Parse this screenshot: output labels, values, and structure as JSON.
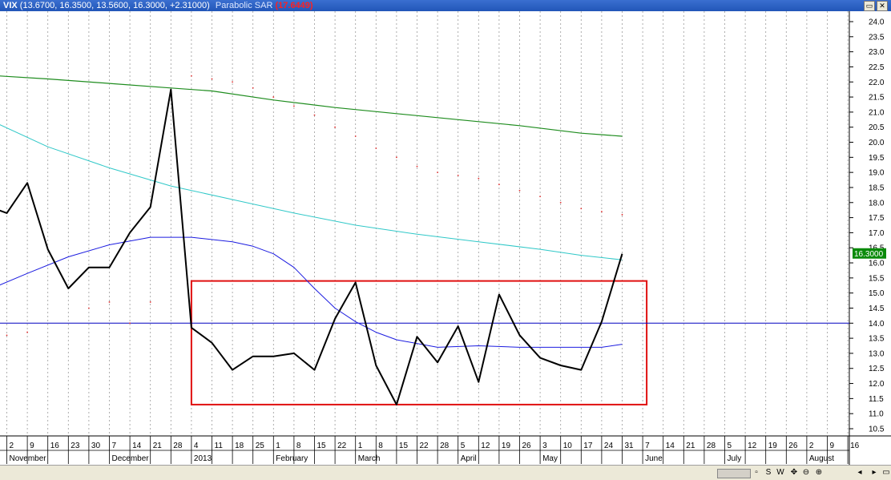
{
  "header": {
    "symbol": "VIX",
    "ohlc": "(13.6700, 16.3500, 13.5600, 16.3000, +2.31000)",
    "indicator_name": "Parabolic SAR",
    "indicator_value": "(17.6449)"
  },
  "window_buttons": {
    "restore": "▭",
    "close": "✕"
  },
  "last_price_tag": "16.3000",
  "colors": {
    "price": "#000000",
    "sma_slow": "#1e8c1e",
    "sma_mid": "#30c8c8",
    "sma_fast": "#1c1ce0",
    "hline": "#0000c0",
    "box": "#e01010",
    "sar": "#e03030"
  },
  "chart_data": {
    "type": "line",
    "title": "",
    "ylim": [
      10.2,
      24.3
    ],
    "y_ticks": [
      "24.0",
      "23.5",
      "23.0",
      "22.5",
      "22.0",
      "21.5",
      "21.0",
      "20.5",
      "20.0",
      "19.5",
      "19.0",
      "18.5",
      "18.0",
      "17.5",
      "17.0",
      "16.5",
      "16.0",
      "15.5",
      "15.0",
      "14.5",
      "14.0",
      "13.5",
      "13.0",
      "12.5",
      "12.0",
      "11.5",
      "11.0",
      "10.5"
    ],
    "x_week_labels": [
      "2",
      "9",
      "16",
      "23",
      "30",
      "7",
      "14",
      "21",
      "28",
      "4",
      "11",
      "18",
      "25",
      "1",
      "8",
      "15",
      "22",
      "1",
      "8",
      "15",
      "22",
      "28",
      "5",
      "12",
      "19",
      "26",
      "3",
      "10",
      "17",
      "24",
      "31",
      "7",
      "14",
      "21",
      "28",
      "5",
      "12",
      "19",
      "26",
      "2",
      "9",
      "16"
    ],
    "x_month_labels": [
      {
        "label": "November",
        "week": 0
      },
      {
        "label": "December",
        "week": 5
      },
      {
        "label": "2013",
        "week": 9
      },
      {
        "label": "February",
        "week": 13
      },
      {
        "label": "March",
        "week": 17
      },
      {
        "label": "April",
        "week": 22
      },
      {
        "label": "May",
        "week": 26
      },
      {
        "label": "June",
        "week": 31
      },
      {
        "label": "July",
        "week": 35
      },
      {
        "label": "August",
        "week": 39
      }
    ],
    "series": [
      {
        "values": [
          {
            "w": -0.4,
            "v": 17.75
          },
          {
            "w": 0,
            "v": 17.65
          },
          {
            "w": 1,
            "v": 18.65
          },
          {
            "w": 2,
            "v": 16.45
          },
          {
            "w": 3,
            "v": 15.15
          },
          {
            "w": 4,
            "v": 15.85
          },
          {
            "w": 5,
            "v": 15.85
          },
          {
            "w": 6,
            "v": 17.0
          },
          {
            "w": 7,
            "v": 17.85
          },
          {
            "w": 8,
            "v": 21.75
          },
          {
            "w": 9,
            "v": 13.85
          },
          {
            "w": 10,
            "v": 13.35
          },
          {
            "w": 11,
            "v": 12.45
          },
          {
            "w": 12,
            "v": 12.9
          },
          {
            "w": 13,
            "v": 12.9
          },
          {
            "w": 14,
            "v": 13.0
          },
          {
            "w": 15,
            "v": 12.45
          },
          {
            "w": 16,
            "v": 14.15
          },
          {
            "w": 17,
            "v": 15.35
          },
          {
            "w": 18,
            "v": 12.6
          },
          {
            "w": 19,
            "v": 11.3
          },
          {
            "w": 20,
            "v": 13.55
          },
          {
            "w": 21,
            "v": 12.7
          },
          {
            "w": 22,
            "v": 13.9
          },
          {
            "w": 23,
            "v": 12.05
          },
          {
            "w": 24,
            "v": 14.95
          },
          {
            "w": 25,
            "v": 13.6
          },
          {
            "w": 26,
            "v": 12.85
          },
          {
            "w": 27,
            "v": 12.6
          },
          {
            "w": 28,
            "v": 12.45
          },
          {
            "w": 29,
            "v": 14.05
          },
          {
            "w": 30,
            "v": 16.3
          }
        ]
      },
      {
        "values": [
          {
            "w": -0.4,
            "v": 22.2
          },
          {
            "w": 2,
            "v": 22.1
          },
          {
            "w": 5,
            "v": 21.95
          },
          {
            "w": 8,
            "v": 21.8
          },
          {
            "w": 10,
            "v": 21.7
          },
          {
            "w": 13,
            "v": 21.4
          },
          {
            "w": 16,
            "v": 21.15
          },
          {
            "w": 19,
            "v": 20.95
          },
          {
            "w": 22,
            "v": 20.75
          },
          {
            "w": 25,
            "v": 20.55
          },
          {
            "w": 28,
            "v": 20.3
          },
          {
            "w": 30,
            "v": 20.2
          }
        ]
      },
      {
        "values": [
          {
            "w": -0.4,
            "v": 20.6
          },
          {
            "w": 2,
            "v": 19.85
          },
          {
            "w": 5,
            "v": 19.15
          },
          {
            "w": 8,
            "v": 18.55
          },
          {
            "w": 11,
            "v": 18.1
          },
          {
            "w": 14,
            "v": 17.65
          },
          {
            "w": 17,
            "v": 17.25
          },
          {
            "w": 20,
            "v": 16.95
          },
          {
            "w": 23,
            "v": 16.7
          },
          {
            "w": 26,
            "v": 16.45
          },
          {
            "w": 28,
            "v": 16.25
          },
          {
            "w": 30,
            "v": 16.1
          }
        ]
      },
      {
        "values": [
          {
            "w": -0.4,
            "v": 15.25
          },
          {
            "w": 1,
            "v": 15.65
          },
          {
            "w": 3,
            "v": 16.2
          },
          {
            "w": 5,
            "v": 16.6
          },
          {
            "w": 7,
            "v": 16.85
          },
          {
            "w": 9,
            "v": 16.85
          },
          {
            "w": 11,
            "v": 16.7
          },
          {
            "w": 12,
            "v": 16.55
          },
          {
            "w": 13,
            "v": 16.3
          },
          {
            "w": 14,
            "v": 15.85
          },
          {
            "w": 15,
            "v": 15.15
          },
          {
            "w": 16,
            "v": 14.5
          },
          {
            "w": 17,
            "v": 14.05
          },
          {
            "w": 18,
            "v": 13.7
          },
          {
            "w": 19,
            "v": 13.45
          },
          {
            "w": 21,
            "v": 13.2
          },
          {
            "w": 23,
            "v": 13.25
          },
          {
            "w": 25,
            "v": 13.2
          },
          {
            "w": 27,
            "v": 13.2
          },
          {
            "w": 29,
            "v": 13.2
          },
          {
            "w": 30,
            "v": 13.3
          }
        ]
      }
    ],
    "sar_points": [
      {
        "w": 0,
        "v": 13.6
      },
      {
        "w": 1,
        "v": 13.7
      },
      {
        "w": 4,
        "v": 14.5
      },
      {
        "w": 5,
        "v": 14.7
      },
      {
        "w": 6,
        "v": 14.0
      },
      {
        "w": 7,
        "v": 14.7
      },
      {
        "w": 9,
        "v": 22.2
      },
      {
        "w": 10,
        "v": 22.1
      },
      {
        "w": 11,
        "v": 22.0
      },
      {
        "w": 12,
        "v": 21.8
      },
      {
        "w": 13,
        "v": 21.5
      },
      {
        "w": 14,
        "v": 21.2
      },
      {
        "w": 15,
        "v": 20.9
      },
      {
        "w": 16,
        "v": 20.5
      },
      {
        "w": 17,
        "v": 20.2
      },
      {
        "w": 18,
        "v": 19.8
      },
      {
        "w": 19,
        "v": 19.5
      },
      {
        "w": 20,
        "v": 19.2
      },
      {
        "w": 21,
        "v": 19.0
      },
      {
        "w": 22,
        "v": 18.9
      },
      {
        "w": 23,
        "v": 18.8
      },
      {
        "w": 24,
        "v": 18.6
      },
      {
        "w": 25,
        "v": 18.4
      },
      {
        "w": 26,
        "v": 18.2
      },
      {
        "w": 27,
        "v": 18.0
      },
      {
        "w": 28,
        "v": 17.8
      },
      {
        "w": 29,
        "v": 17.7
      },
      {
        "w": 30,
        "v": 17.6
      }
    ],
    "horizontal_line": 14.0,
    "box": {
      "w0": 9,
      "w1": 31,
      "v0": 11.3,
      "v1": 15.4
    },
    "grid": "vertical-dotted"
  },
  "statusbar": {
    "buttons": [
      "▫",
      "S",
      "W",
      "✥",
      "⊖",
      "⊕",
      "◂",
      "▸",
      "▭"
    ]
  }
}
